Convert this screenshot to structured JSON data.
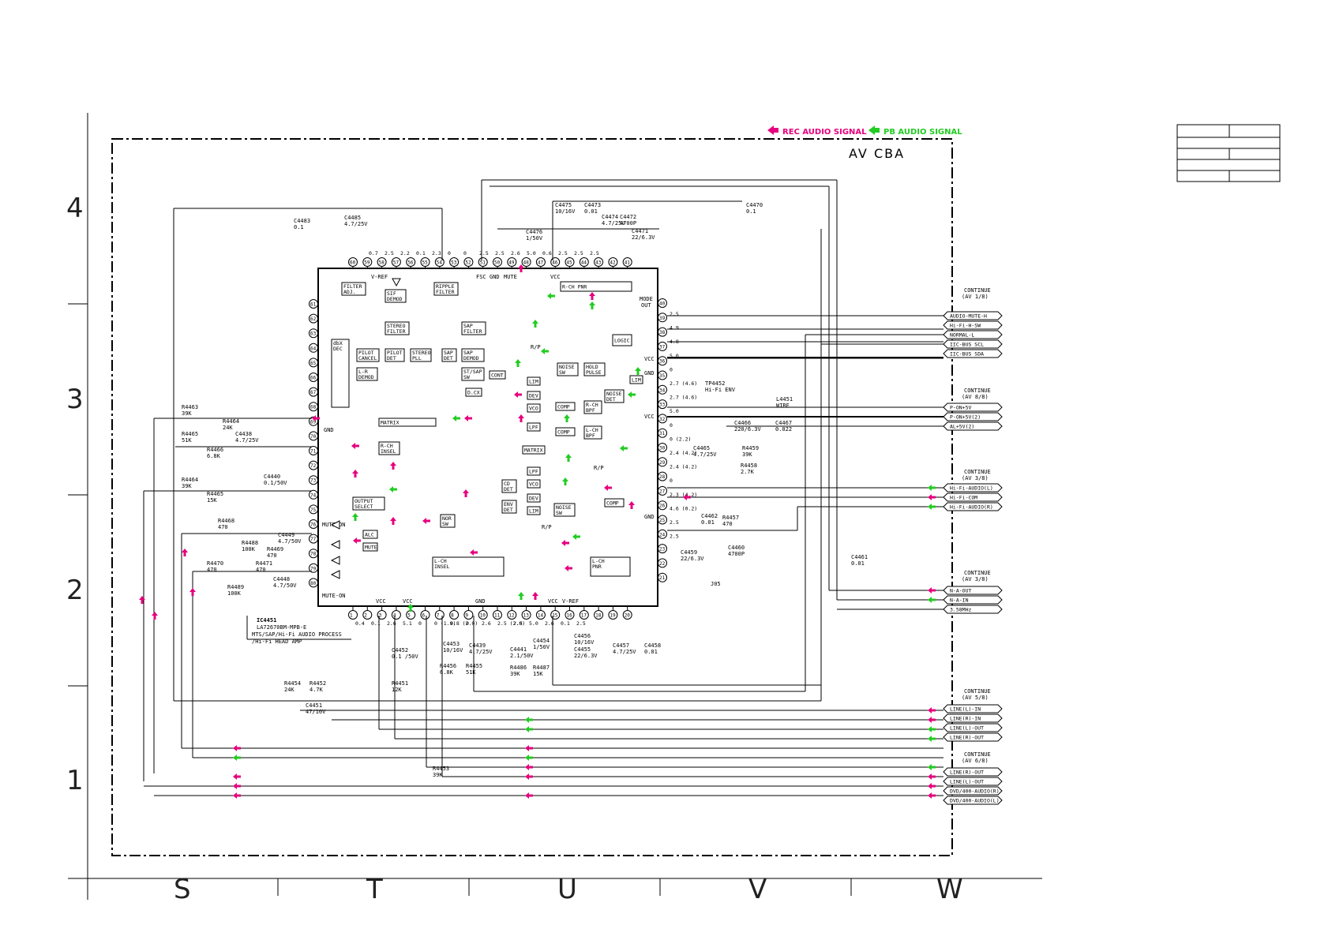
{
  "legend": {
    "rec": "REC AUDIO SIGNAL",
    "pb": "PB AUDIO SIGNAL",
    "rec_color": "#e6007e",
    "pb_color": "#22cc22"
  },
  "board_title": "AV CBA",
  "ic": {
    "ref": "IC4451",
    "part": "LA72670BM-MPB-E",
    "desc1": "MTS/SAP/Hi-Fi AUDIO PROCESS",
    "desc2": "/Hi-Fi HEAD AMP"
  },
  "grid": {
    "rows": [
      "4",
      "3",
      "2",
      "1"
    ],
    "cols": [
      "S",
      "T",
      "U",
      "V",
      "W"
    ]
  },
  "blocks": {
    "filter_adj": "FILTER ADJ.",
    "sif_demod": "SIF DEMOD",
    "ripple_filter": "RIPPLE FILTER",
    "fsc": "FSC",
    "gnd": "GND",
    "mute": "MUTE",
    "vcc": "VCC",
    "vref": "V-REF",
    "rch_pnr": "R-CH PNR",
    "stereo_filter": "STEREO FILTER",
    "sap_filter": "SAP FILTER",
    "pilot_cancel": "PILOT CANCEL",
    "pilot_det": "PILOT DET",
    "stereo_pll": "STEREO PLL",
    "sap_det": "SAP DET",
    "sap_demod": "SAP DEMOD",
    "dbx_dec": "dbX DEC",
    "lr_demod": "L-R DEMOD",
    "st_sap_sw": "ST/SAP SW",
    "cont": "CONT",
    "dcx": "D.CX",
    "matrix": "MATRIX",
    "rch_insel": "R-CH INSEL",
    "output_select": "OUTPUT SELECT",
    "mute_on": "MUTE-ON",
    "alc": "ALC",
    "mute_blk": "MUTE",
    "nor_sw": "NOR SW",
    "lch_insel": "L-CH INSEL",
    "lch_pnr": "L-CH PNR",
    "logic": "LOGIC",
    "hold_pulse": "HOLD PULSE",
    "noise_sw": "NOISE SW",
    "noise_det": "NOISE DET",
    "lim": "LIM",
    "dev": "DEV",
    "vco": "VCO",
    "comp": "COMP",
    "rch_bpf": "R-CH BPF",
    "lch_bpf": "L-CH BPF",
    "lpf": "LPF",
    "cd_det": "CD DET",
    "env_det": "ENV DET",
    "mode_out": "MODE OUT",
    "rp": "R/P"
  },
  "components": [
    "C4483 0.1",
    "C4485 4.7/25V",
    "C4470 0.1",
    "C4475 10/16V",
    "C4473 0.01",
    "C4474 4.7/25V",
    "C4472 4700P",
    "C4471 22/6.3V",
    "C4476 1/50V",
    "R4463 39K",
    "R4464 24K",
    "R4465 51K",
    "R4466 6.8K",
    "C4438 4.7/25V",
    "R4464 39K",
    "R4465 15K",
    "C4440 0.1/50V",
    "R4468 470",
    "R4488 100K",
    "R4469 470",
    "C4449 4.7/50V",
    "R4470 470",
    "R4471 470",
    "C4448 4.7/50V",
    "R4489 100K",
    "TP4452 Hi-Fi ENV",
    "L4451 WIRE",
    "C4466 220/6.3V",
    "C4467 0.022",
    "C4465 4.7/25V",
    "R4459 39K",
    "R4458 2.7K",
    "C4462 0.01",
    "R4457 470",
    "C4460 4700P",
    "C4459 22/6.3V",
    "J05",
    "C4461 0.01",
    "C4452 0.1 /50V",
    "C4453 10/16V",
    "C4439 4.7/25V",
    "R4456 6.8K",
    "R4455 51K",
    "C4441 2.1/50V",
    "C4454 1/50V",
    "R4486 39K",
    "R4487 15K",
    "C4456 10/16V",
    "C4455 22/6.3V",
    "C4457 4.7/25V",
    "C4458 0.01",
    "R4454 24K",
    "R4452 4.7K",
    "R4451 12K",
    "C4451 47/10V",
    "R4453 39K"
  ],
  "top_pins": [
    "60",
    "59",
    "58",
    "57",
    "56",
    "55",
    "54",
    "53",
    "52",
    "51",
    "50",
    "49",
    "48",
    "47",
    "46",
    "45",
    "44",
    "43",
    "42",
    "41"
  ],
  "top_volts": [
    "0.7",
    "2.5",
    "2.2",
    "0.1",
    "2.3",
    "0",
    "0",
    "2.5",
    "2.5",
    "2.6",
    "5.0",
    "0.6",
    "2.5",
    "2.5",
    "2.5"
  ],
  "left_pins": [
    "61",
    "62",
    "63",
    "64",
    "65",
    "66",
    "67",
    "68",
    "69",
    "70",
    "71",
    "72",
    "73",
    "74",
    "75",
    "76",
    "77",
    "78",
    "79",
    "80"
  ],
  "right_pins": [
    "40",
    "39",
    "38",
    "37",
    "36",
    "35",
    "34",
    "33",
    "32",
    "31",
    "30",
    "29",
    "28",
    "27",
    "26",
    "25",
    "24",
    "23",
    "22",
    "21"
  ],
  "right_volts": [
    "2.5",
    "4.9",
    "4.8",
    "5.0",
    "0",
    "2.7 (4.6)",
    "2.7 (4.6)",
    "5.0",
    "0",
    "0 (2.2)",
    "2.4 (4.2)",
    "2.4 (4.2)",
    "0",
    "2.3 (4.2)",
    "4.6 (0.2)",
    "2.5",
    "2.5"
  ],
  "bottom_pins": [
    "1",
    "2",
    "3",
    "4",
    "5",
    "6",
    "7",
    "8",
    "9",
    "10",
    "11",
    "12",
    "13",
    "14",
    "15",
    "16",
    "17",
    "18",
    "19",
    "20"
  ],
  "bottom_volts": [
    "0.4",
    "0.1",
    "2.6",
    "5.1",
    "0",
    "0 (1.9)",
    "0.8 (2.0)",
    "0",
    "2.6",
    "2.5 (2.0)",
    "2.5",
    "5.0",
    "2.6",
    "0.1",
    "2.5"
  ],
  "pin_labels": {
    "vcc": "VCC",
    "vref": "V-REF",
    "gnd": "GND"
  },
  "connectors": [
    {
      "continue": "CONTINUE (AV 1/8)",
      "signals": [
        "AUDIO-MUTE-H",
        "Hi-Fi-H-SW",
        "NORMAL-L",
        "IIC-BUS SCL",
        "IIC-BUS SDA"
      ]
    },
    {
      "continue": "CONTINUE (AV 8/8)",
      "signals": [
        "P-ON+5V",
        "P-ON+5V(2)",
        "AL+5V(2)"
      ]
    },
    {
      "continue": "CONTINUE (AV 3/8)",
      "signals": [
        "Hi-Fi-AUDIO(L)",
        "Hi-Fi-COM",
        "Hi-Fi-AUDIO(R)"
      ]
    },
    {
      "continue": "CONTINUE (AV 3/8)",
      "signals": [
        "N-A-OUT",
        "N-A-IN",
        "3.58MHz"
      ]
    },
    {
      "continue": "CONTINUE (AV 5/8)",
      "signals": [
        "LINE(L)-IN",
        "LINE(R)-IN",
        "LINE(L)-OUT",
        "LINE(R)-OUT"
      ]
    },
    {
      "continue": "CONTINUE (AV 6/8)",
      "signals": [
        "LINE(R)-OUT",
        "LINE(L)-OUT",
        "DVD/400-AUDIO(R)",
        "DVD/400-AUDIO(L)"
      ]
    }
  ]
}
